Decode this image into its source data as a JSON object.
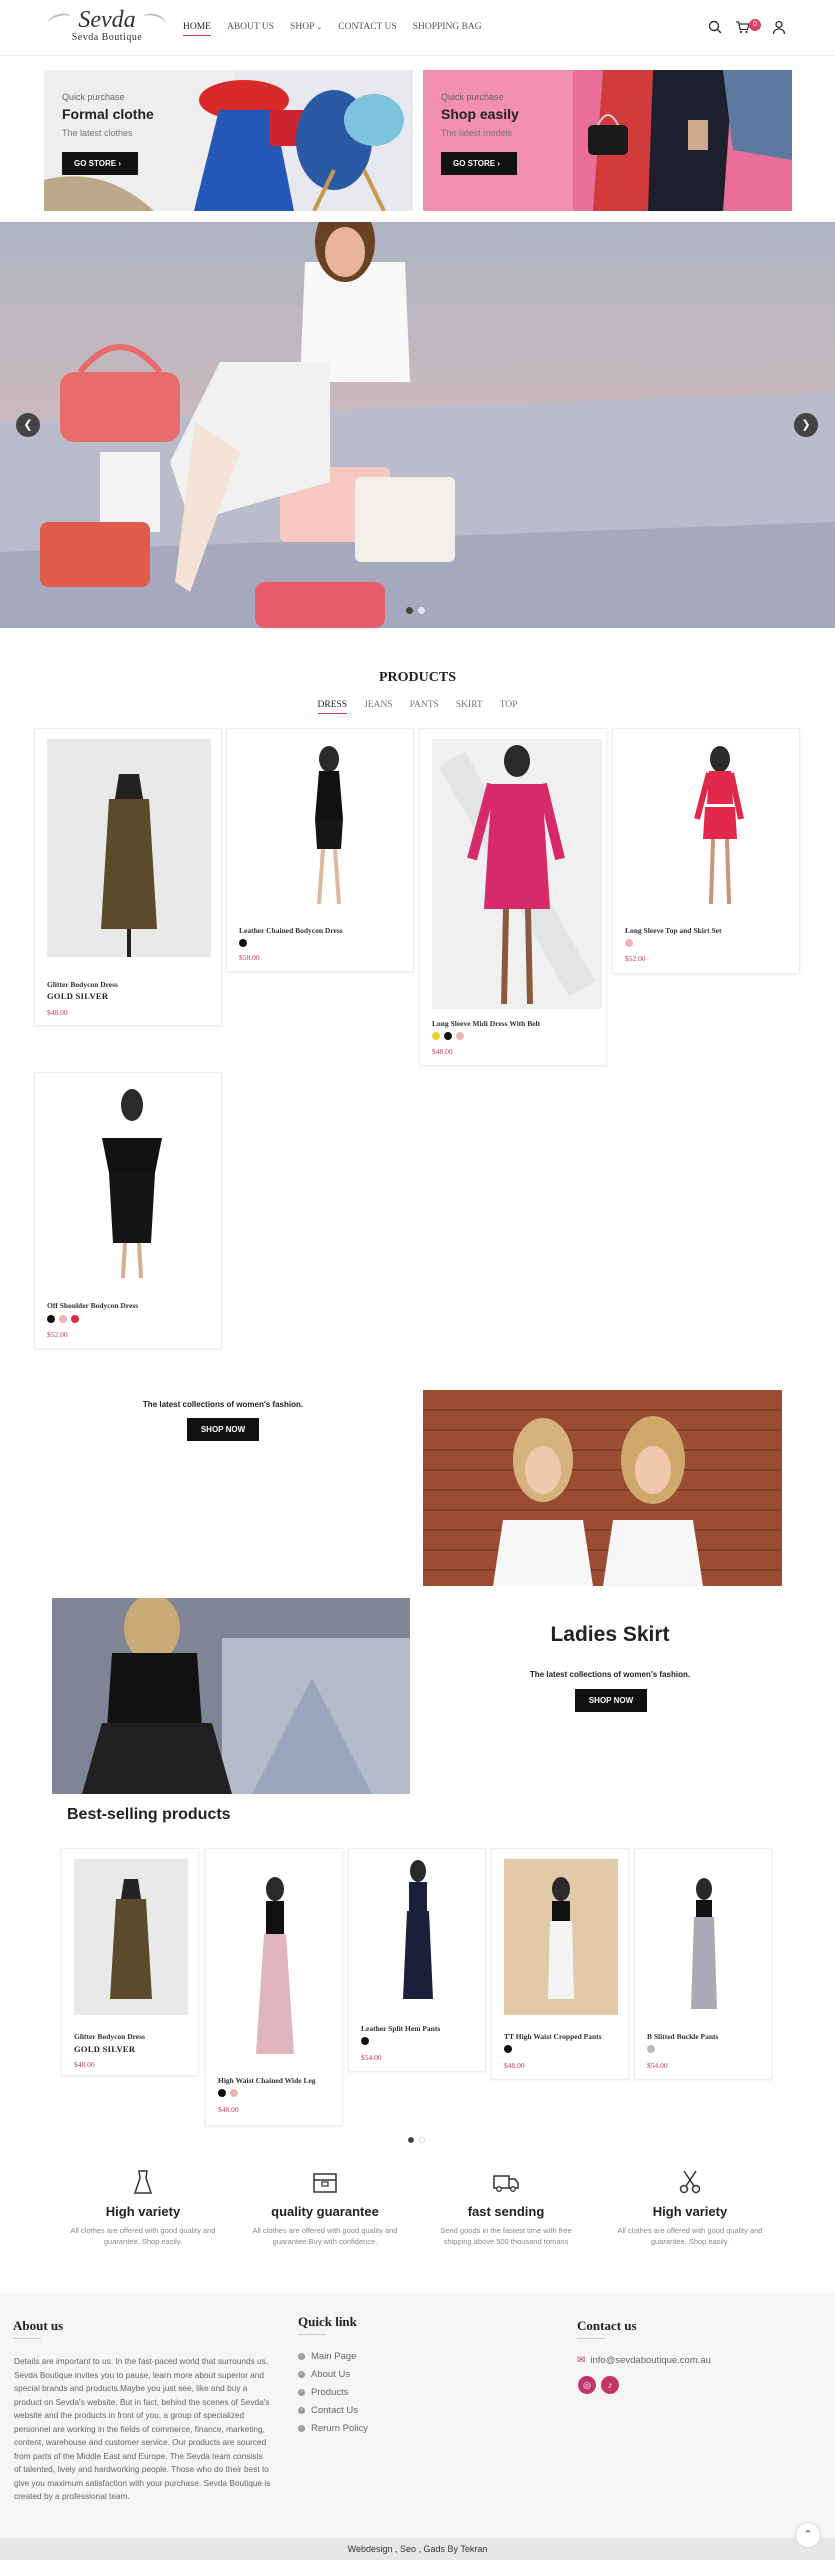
{
  "header": {
    "logo_main": "Sevda",
    "logo_sub": "Sevda Boutique",
    "nav": [
      "HOME",
      "ABOUT US",
      "SHOP",
      "CONTACT US",
      "SHOPPING BAG"
    ],
    "cart_count": "0"
  },
  "promos": [
    {
      "small": "Quick purchase",
      "title": "Formal clothe",
      "sub": "The latest clothes",
      "button": "GO STORE"
    },
    {
      "small": "Quick purchase",
      "title": "Shop easily",
      "sub": "The latest models",
      "button": "GO STORE"
    }
  ],
  "products": {
    "title": "PRODUCTS",
    "tabs": [
      "DRESS",
      "JEANS",
      "PANTS",
      "SKIRT",
      "TOP"
    ],
    "items": [
      {
        "name": "Glitter Bodycon Dress",
        "options": "GOLD  SILVER",
        "price": "$48.00"
      },
      {
        "name": "Leather Chained Bodycon Dress",
        "price": "$58.00"
      },
      {
        "name": "Long Sleeve Midi Dress With Belt",
        "price": "$48.00"
      },
      {
        "name": "Long Sleeve Top and Skirt Set",
        "price": "$52.00"
      },
      {
        "name": "Off Shoulder Bodycon Dress",
        "price": "$52.00"
      }
    ]
  },
  "banner1": {
    "sub": "The latest collections of women's fashion.",
    "button": "SHOP NOW"
  },
  "banner2": {
    "title": "Ladies Skirt",
    "sub": "The latest collections of women's fashion.",
    "button": "SHOP NOW"
  },
  "bestselling": {
    "title": "Best-selling products",
    "items": [
      {
        "name": "Glitter Bodycon Dress",
        "options": "GOLD  SILVER",
        "price": "$48.00"
      },
      {
        "name": "High Waist Chained Wide Leg",
        "price": "$48.00"
      },
      {
        "name": "Leather Split Hem Pants",
        "price": "$54.00"
      },
      {
        "name": "TT High Waist Cropped Pants",
        "price": "$48.00"
      },
      {
        "name": "B Slitted Buckle Pants",
        "price": "$54.00"
      }
    ]
  },
  "features": [
    {
      "title": "High variety",
      "desc": "All clothes are offered with good quality and guarantee. Shop easily."
    },
    {
      "title": "quality guarantee",
      "desc": "All clothes are offered with good quality and guarantee.Buy with confidence."
    },
    {
      "title": "fast sending",
      "desc": "Send goods in the fastest time with free shipping above 500 thousand tomans"
    },
    {
      "title": "High variety",
      "desc": "All clothes are offered with good quality and guarantee. Shop easily."
    }
  ],
  "footer": {
    "about_title": "About us",
    "about_text": "Details are important to us. In the fast-paced world that surrounds us, Sevda Boutique invites you to pause, learn more about superior and special brands and products.Maybe you just see, like and buy a product on Sevda's website. But in fact, behind the scenes of Sevda's website and the products in front of you, a group of specialized personnel are working in the fields of commerce, finance, marketing, content, warehouse and customer service. Our products are sourced from parts of the Middle East and Europe. The Sevda team consists of talented, lively and hardworking people. Those who do their best to give you maximum satisfaction with your purchase. Sevda Boutique is created by a professional team.",
    "quick_title": "Quick link",
    "quick_links": [
      "Main Page",
      "About Us",
      "Products",
      "Contact Us",
      "Rerurn Policy"
    ],
    "contact_title": "Contact us",
    "email": "info@sevdaboutique.com.au",
    "copyright": "Webdesign , Seo , Gads By Tekran"
  },
  "colors": {
    "accent": "#c23a57",
    "button": "#111111",
    "promo2_bg": "#f08fb0"
  }
}
